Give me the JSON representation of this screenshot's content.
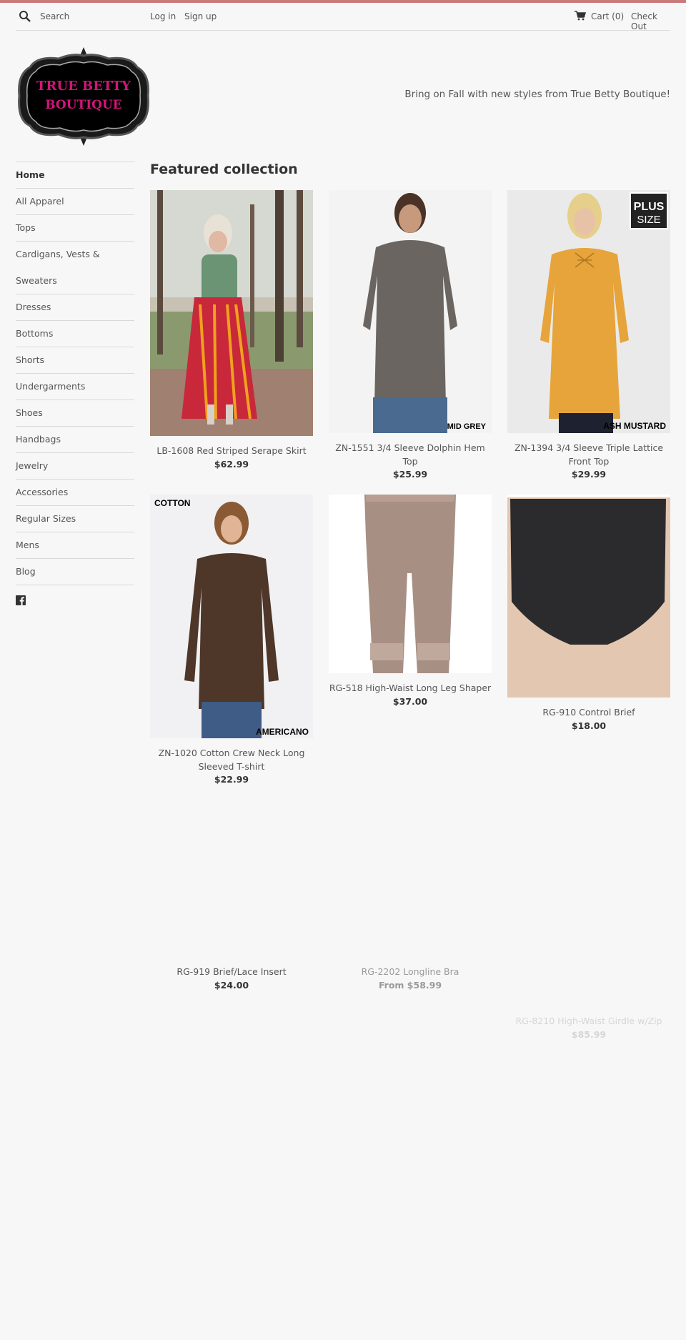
{
  "header": {
    "search_placeholder": "Search",
    "login": "Log in",
    "signup": "Sign up",
    "cart": "Cart (0)",
    "checkout": "Check Out"
  },
  "brand": {
    "logo_line1": "TRUE BETTY",
    "logo_line2": "BOUTIQUE",
    "tagline": "Bring on Fall with new styles from True Betty Boutique!",
    "accent": "#c97b7b",
    "logo_text_color": "#d4147a"
  },
  "sidebar": {
    "items": [
      {
        "label": "Home"
      },
      {
        "label": "All Apparel"
      },
      {
        "label": "Tops"
      },
      {
        "label": "Cardigans, Vests & Sweaters"
      },
      {
        "label": "Dresses"
      },
      {
        "label": "Bottoms"
      },
      {
        "label": "Shorts"
      },
      {
        "label": "Undergarments"
      },
      {
        "label": "Shoes"
      },
      {
        "label": "Handbags"
      },
      {
        "label": "Jewelry"
      },
      {
        "label": "Accessories"
      },
      {
        "label": "Regular Sizes"
      },
      {
        "label": "Mens"
      },
      {
        "label": "Blog"
      }
    ],
    "social_icon": "facebook-icon"
  },
  "main": {
    "title": "Featured collection",
    "products": [
      {
        "title": "LB-1608 Red Striped Serape Skirt",
        "price": "$62.99"
      },
      {
        "title": "ZN-1551 3/4 Sleeve Dolphin Hem Top",
        "price": "$25.99",
        "badge": "MID GREY"
      },
      {
        "title": "ZN-1394 3/4 Sleeve Triple Lattice Front Top",
        "price": "$29.99",
        "badge": "ASH MUSTARD",
        "badge2_line1": "PLUS",
        "badge2_line2": "SIZE"
      },
      {
        "title": "ZN-1020 Cotton Crew Neck Long Sleeved T-shirt",
        "price": "$22.99",
        "badge": "AMERICANO",
        "badge_top": "COTTON"
      },
      {
        "title": "RG-518 High-Waist Long Leg Shaper",
        "price": "$37.00"
      },
      {
        "title": "RG-910 Control Brief",
        "price": "$18.00"
      },
      {
        "title": "RG-919 Brief/Lace Insert",
        "price": "$24.00"
      },
      {
        "title": "RG-2202 Longline Bra",
        "price": "From $58.99"
      },
      {
        "title": "RG-8210 High-Waist Girdle w/Zip",
        "price": "$85.99"
      }
    ]
  }
}
